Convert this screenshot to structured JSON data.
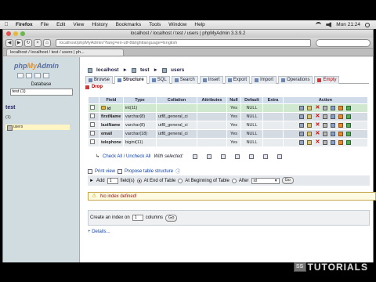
{
  "menubar": {
    "app": "Firefox",
    "items": [
      "File",
      "Edit",
      "View",
      "History",
      "Bookmarks",
      "Tools",
      "Window",
      "Help"
    ],
    "clock": "Mon 21:24"
  },
  "window": {
    "title": "localhost / localhost / test / users | phpMyAdmin 3.3.9.2",
    "url": "localhost/phpMyAdmin/?lang=en-utf-8&lightlanguage=English",
    "tab": "localhost / localhost / test / users | ph..."
  },
  "sidebar": {
    "logo_php": "php",
    "logo_my": "My",
    "logo_admin": "Admin",
    "database_label": "Database",
    "database_select": "test (1)",
    "db_name": "test",
    "db_count": "(1)",
    "table_item": "users"
  },
  "breadcrumb": {
    "server": "localhost",
    "database": "test",
    "table": "users"
  },
  "tabs": [
    {
      "label": "Browse"
    },
    {
      "label": "Structure"
    },
    {
      "label": "SQL"
    },
    {
      "label": "Search"
    },
    {
      "label": "Insert"
    },
    {
      "label": "Export"
    },
    {
      "label": "Import"
    },
    {
      "label": "Operations"
    },
    {
      "label": "Empty"
    }
  ],
  "drop_label": "Drop",
  "structure": {
    "headers": [
      "Field",
      "Type",
      "Collation",
      "Attributes",
      "Null",
      "Default",
      "Extra",
      "Action"
    ],
    "rows": [
      {
        "field": "id",
        "type": "int(11)",
        "collation": "",
        "null": "Yes",
        "default": "NULL"
      },
      {
        "field": "firstName",
        "type": "varchar(8)",
        "collation": "utf8_general_ci",
        "null": "Yes",
        "default": "NULL"
      },
      {
        "field": "lastName",
        "type": "varchar(8)",
        "collation": "utf8_general_ci",
        "null": "Yes",
        "default": "NULL"
      },
      {
        "field": "email",
        "type": "varchar(18)",
        "collation": "utf8_general_ci",
        "null": "Yes",
        "default": "NULL"
      },
      {
        "field": "telephone",
        "type": "bigint(11)",
        "collation": "",
        "null": "Yes",
        "default": "NULL"
      }
    ]
  },
  "check_all": "Check All / Uncheck All",
  "with_selected": "With selected:",
  "print_view": "Print view",
  "propose": "Propose table structure",
  "add_fields": {
    "add": "Add",
    "count": "1",
    "fields": "field(s)",
    "at_end": "At End of Table",
    "at_beginning": "At Beginning of Table",
    "after": "After",
    "after_select": "id",
    "go": "Go"
  },
  "warning": "No index defined!",
  "create_index": {
    "prefix": "Create an index on",
    "count": "1",
    "suffix": "columns",
    "go": "Go"
  },
  "details": "Details...",
  "watermark": {
    "mark": "SS",
    "text": "TUTORIALS"
  }
}
